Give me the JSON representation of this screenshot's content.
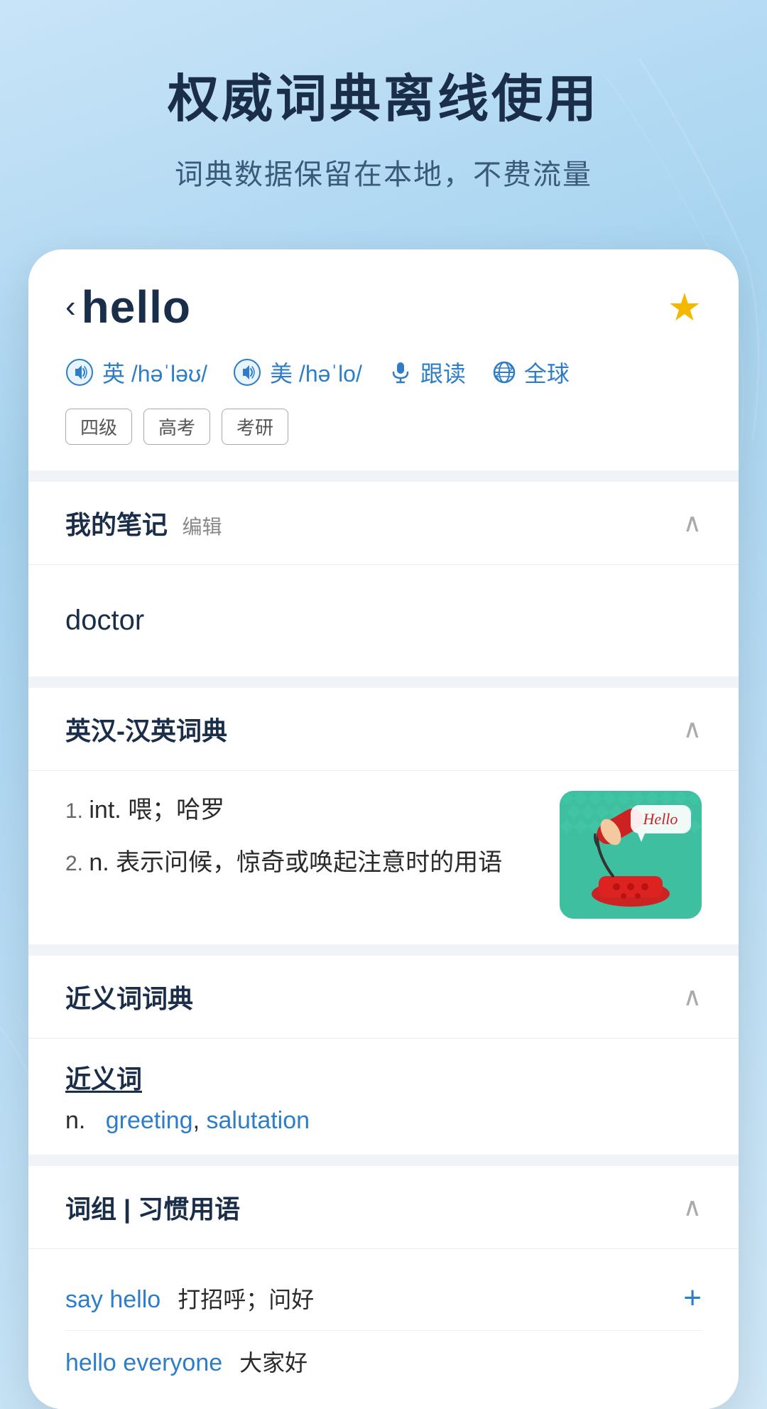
{
  "top": {
    "main_title": "权威词典离线使用",
    "sub_title": "词典数据保留在本地，不费流量"
  },
  "word_header": {
    "back_symbol": "‹",
    "word": "hello",
    "star_symbol": "★",
    "pronunciations": [
      {
        "flag": "英",
        "ipa": "/həˈləʊ/"
      },
      {
        "flag": "美",
        "ipa": "/həˈlo/"
      }
    ],
    "follow_read_label": "跟读",
    "global_label": "全球",
    "tags": [
      "四级",
      "高考",
      "考研"
    ]
  },
  "notes_section": {
    "title": "我的笔记",
    "edit_label": "编辑",
    "chevron": "∧",
    "content": "doctor"
  },
  "dictionary_section": {
    "title": "英汉-汉英词典",
    "chevron": "∧",
    "definitions": [
      {
        "num": "1.",
        "pos": "int.",
        "text": "喂；哈罗"
      },
      {
        "num": "2.",
        "pos": "n.",
        "text": "表示问候，惊奇或唤起注意时的用语"
      }
    ]
  },
  "synonym_section": {
    "title": "近义词词典",
    "chevron": "∧",
    "synonym_heading": "近义词",
    "part_of_speech": "n.",
    "synonyms": [
      "greeting",
      "salutation"
    ]
  },
  "phrase_section": {
    "title": "词组 | 习惯用语",
    "chevron": "∧",
    "phrases": [
      {
        "phrase": "say hello",
        "meaning": "打招呼；问好",
        "has_plus": true
      },
      {
        "phrase": "hello everyone",
        "meaning": "大家好",
        "has_plus": false
      }
    ]
  },
  "colors": {
    "blue_accent": "#2d7dc8",
    "dark_navy": "#1a2e4a",
    "star_yellow": "#f5b800",
    "bg_gradient_start": "#c8e4f8",
    "section_bg": "#ffffff"
  }
}
